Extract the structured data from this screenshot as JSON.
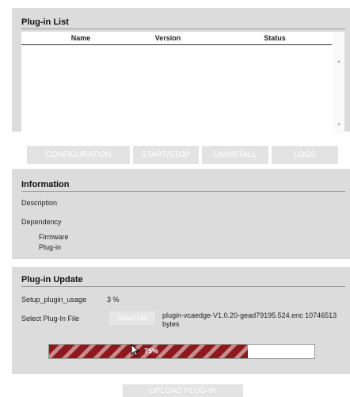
{
  "plugin_list": {
    "title": "Plug-in List",
    "columns": [
      "Name",
      "Version",
      "Status"
    ]
  },
  "actions": {
    "configuration": "CONFIGURATION",
    "start_stop": "START/STOP",
    "uninstall": "UNINSTALL",
    "logs": "LOGS"
  },
  "information": {
    "title": "Information",
    "description_label": "Description",
    "dependency_label": "Dependency",
    "firmware_label": "Firmware",
    "plugin_label": "Plug-in"
  },
  "update": {
    "title": "Plug-in Update",
    "usage_label": "Setup_plugin_usage",
    "usage_value": "3 %",
    "select_label": "Select Plug-In File",
    "select_button": "Select File",
    "file_info": "plugin-vcaedge-V1.0.20-gead79195.524.enc 10746513 bytes",
    "progress_value": 0.75,
    "progress_text": "75%",
    "upload_button": "UPLOAD PLUG-IN"
  },
  "colors": {
    "panel_bg": "#dcdcdc",
    "progress": "#8b1a1f",
    "disabled_button": "#e3e3e3"
  }
}
